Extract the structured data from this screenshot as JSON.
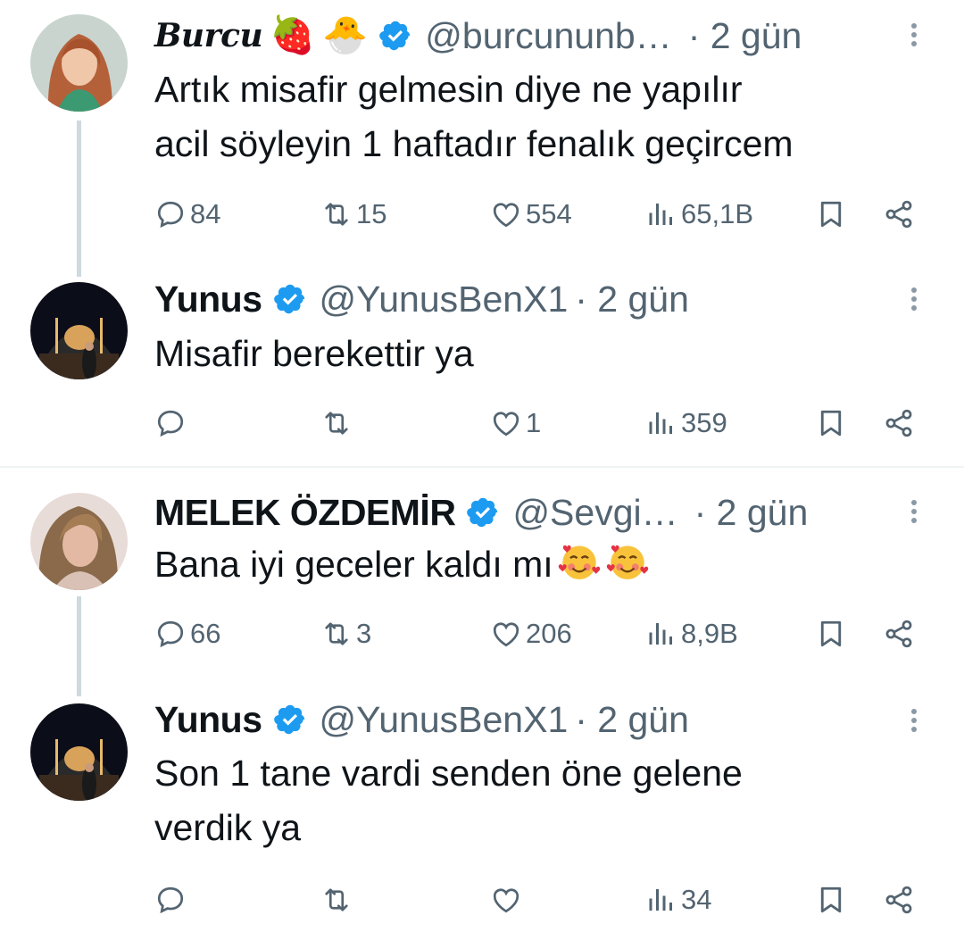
{
  "tweets": [
    {
      "name": "Burcu",
      "emojis": [
        "🍓",
        "🐣"
      ],
      "handle": "@burcununb…",
      "time": "· 2 gün",
      "text_lines": [
        "Artık misafir gelmesin diye ne yapılır",
        "acil söyleyin 1 haftadır fenalık geçircem"
      ],
      "replies": "84",
      "retweets": "15",
      "likes": "554",
      "views": "65,1B"
    },
    {
      "name": "Yunus",
      "handle": "@YunusBenX1",
      "time": "· 2 gün",
      "text_lines": [
        "Misafir berekettir ya"
      ],
      "replies": "",
      "retweets": "",
      "likes": "1",
      "views": "359"
    },
    {
      "name": "MELEK ÖZDEMİR",
      "handle": "@Sevgi…",
      "time": "· 2 gün",
      "text_lines": [
        "Bana iyi geceler kaldı mı"
      ],
      "text_emoji": "smiling-face-with-hearts x2",
      "replies": "66",
      "retweets": "3",
      "likes": "206",
      "views": "8,9B"
    },
    {
      "name": "Yunus",
      "handle": "@YunusBenX1",
      "time": "· 2 gün",
      "text_lines": [
        "Son 1 tane vardi senden öne gelene",
        "verdik ya"
      ],
      "replies": "",
      "retweets": "",
      "likes": "",
      "views": "34"
    }
  ],
  "colors": {
    "verified": "#1d9bf0",
    "secondary": "#536471",
    "thread": "#cfd9de",
    "text": "#0f1419"
  },
  "icons": [
    "reply-icon",
    "retweet-icon",
    "like-icon",
    "views-icon",
    "bookmark-icon",
    "share-icon",
    "more-icon",
    "verified-badge-icon"
  ]
}
